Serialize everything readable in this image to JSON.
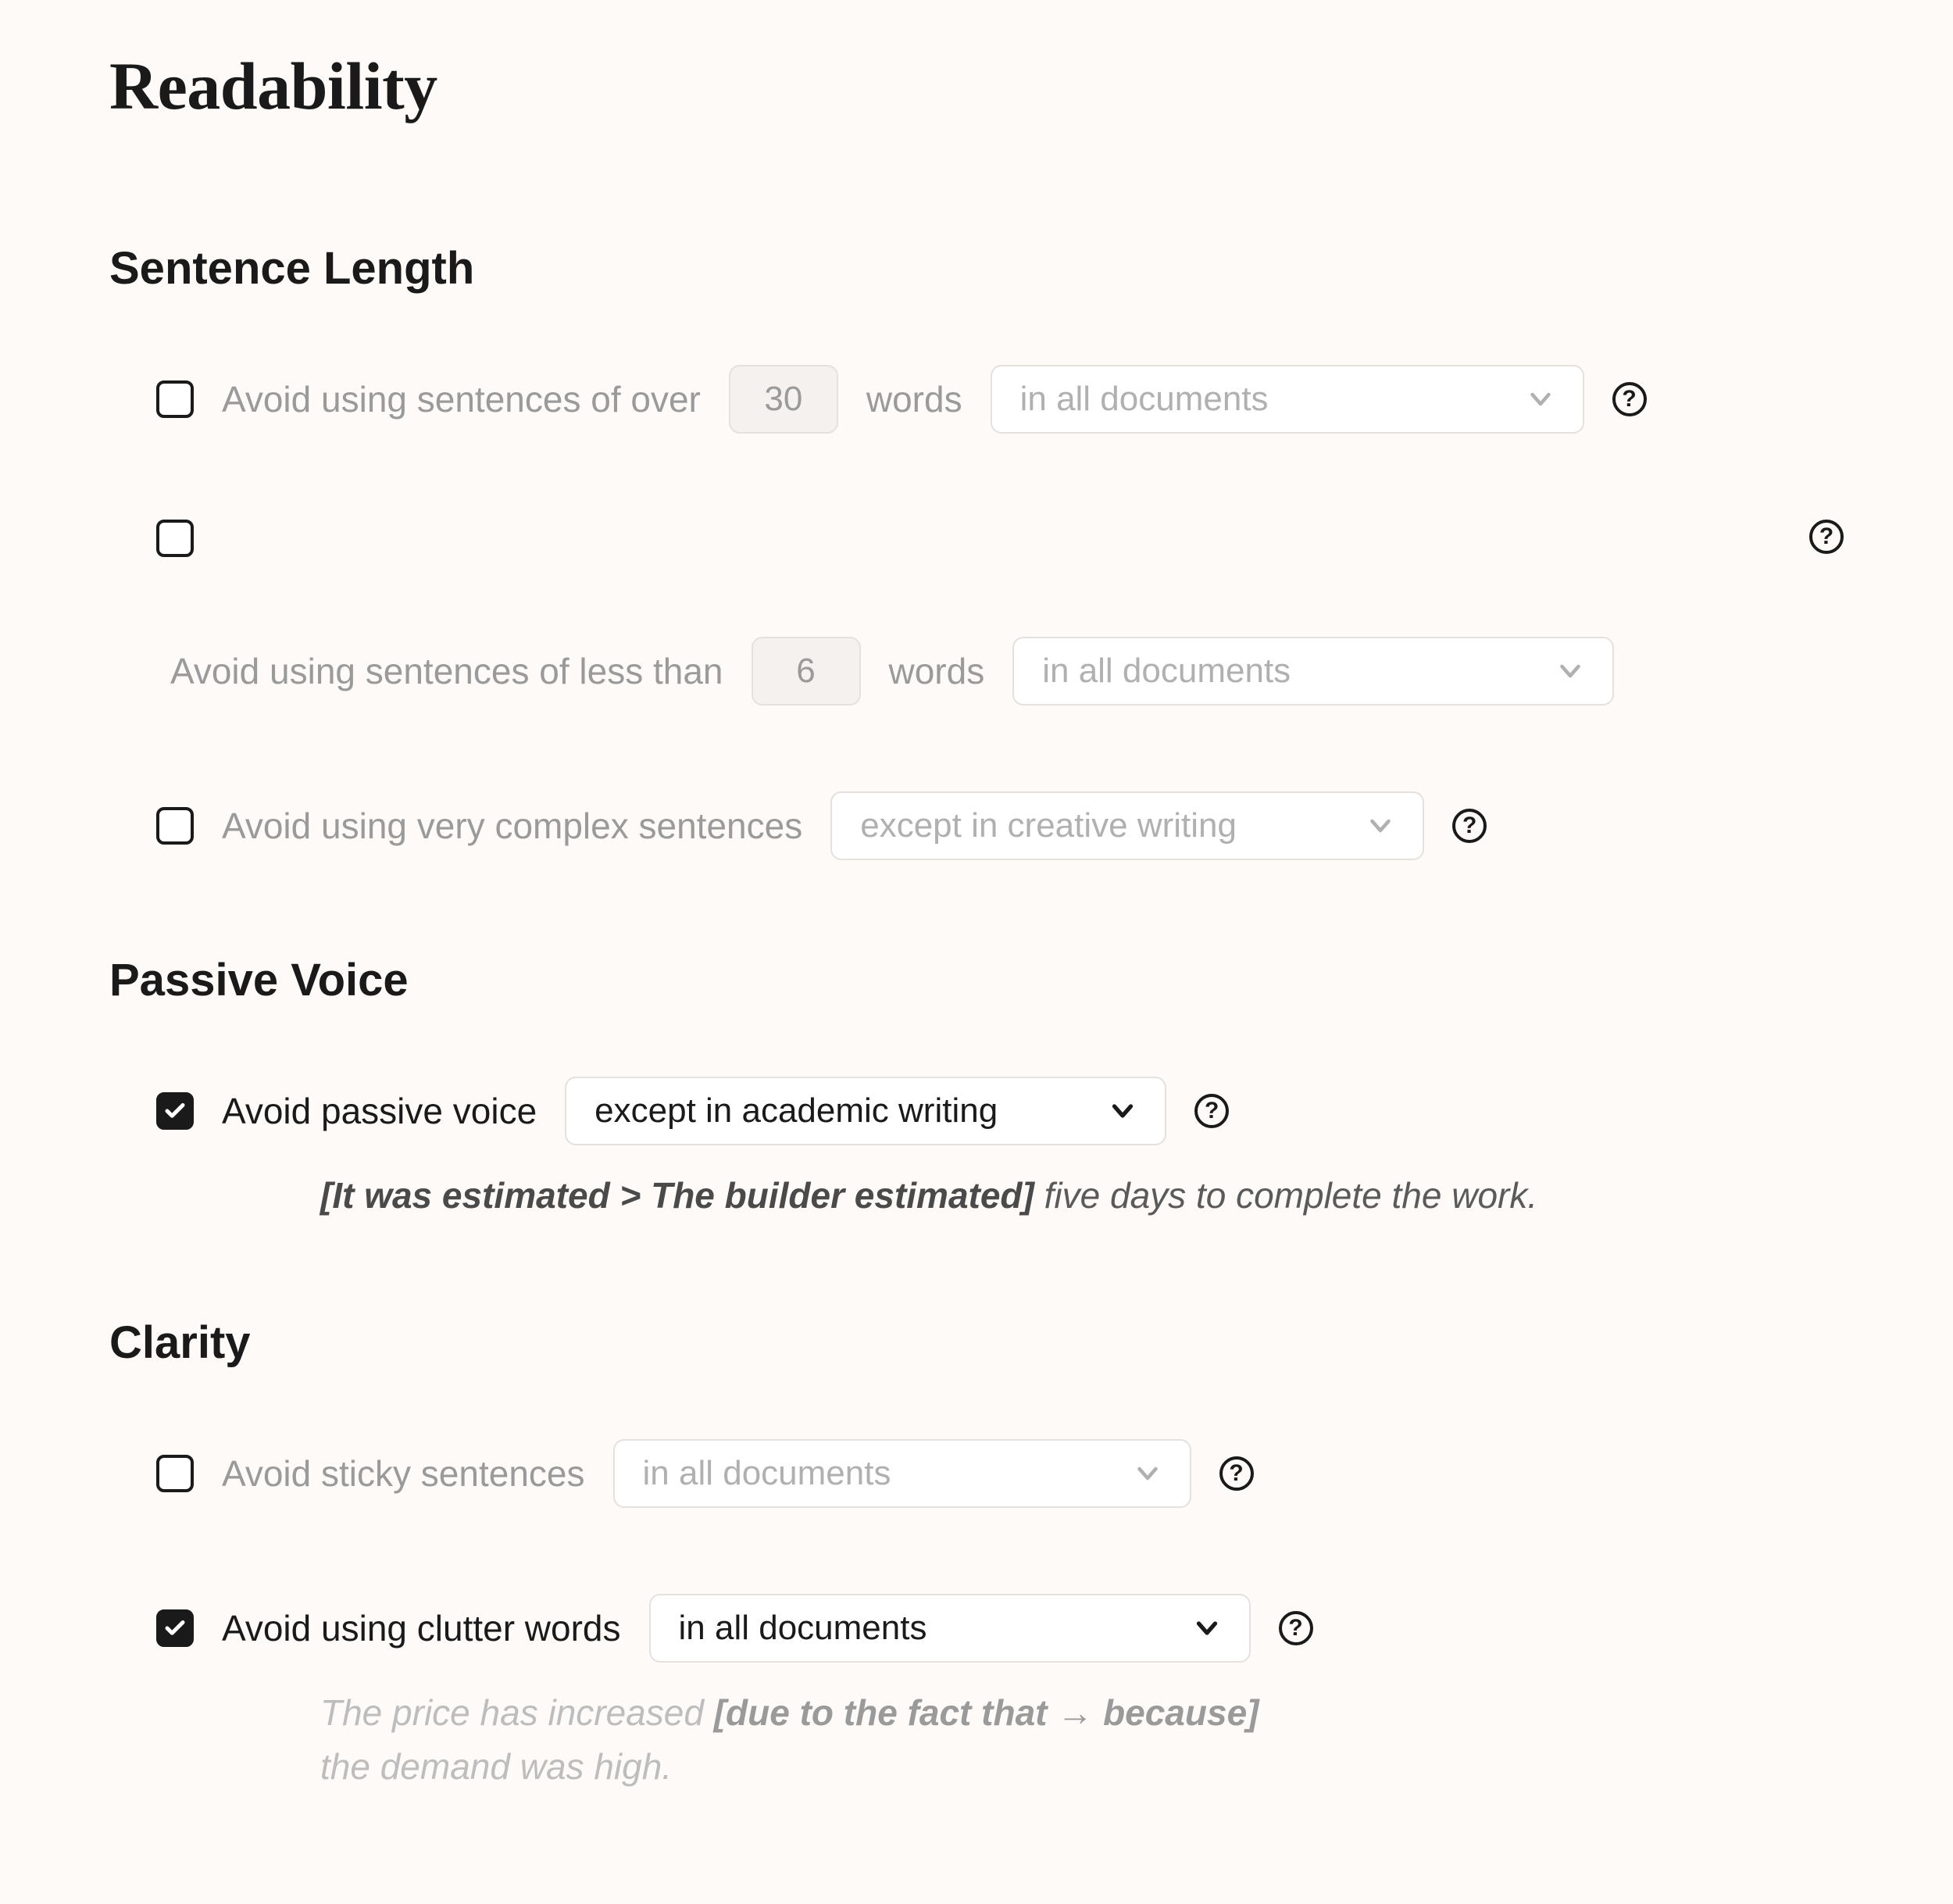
{
  "page": {
    "title": "Readability"
  },
  "sections": {
    "sentence_length": {
      "title": "Sentence Length",
      "over": {
        "checked": false,
        "label_before": "Avoid using sentences of over",
        "value": "30",
        "label_after": "words",
        "scope": "in all documents"
      },
      "under": {
        "checked": false,
        "label_before": "Avoid using sentences of less than",
        "value": "6",
        "label_after": "words",
        "scope": "in all documents"
      },
      "complex": {
        "checked": false,
        "label": "Avoid using very complex sentences",
        "scope": "except in creative writing"
      }
    },
    "passive_voice": {
      "title": "Passive Voice",
      "avoid": {
        "checked": true,
        "label": "Avoid passive voice",
        "scope": "except in academic writing",
        "example_bold": "[It was estimated > The builder estimated]",
        "example_rest": " five days to complete the work."
      }
    },
    "clarity": {
      "title": "Clarity",
      "sticky": {
        "checked": false,
        "label": "Avoid sticky sentences",
        "scope": "in all documents"
      },
      "clutter": {
        "checked": true,
        "label": "Avoid using clutter words",
        "scope": "in all documents",
        "example_before": "The price has increased ",
        "example_bold": "[due to the fact that → because]",
        "example_after": " the demand was high."
      }
    }
  }
}
